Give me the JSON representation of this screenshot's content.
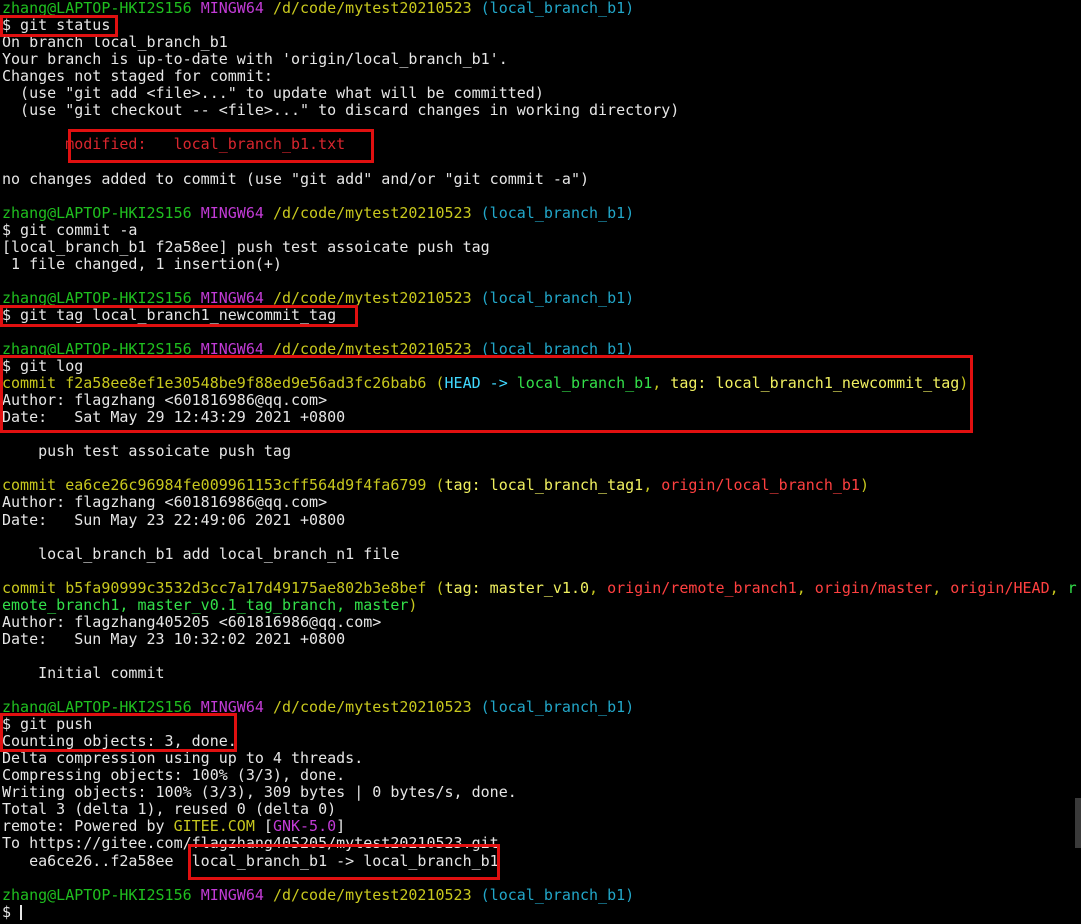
{
  "terminal": {
    "lines": [
      [
        [
          "zhang@LAPTOP-HKI2S156 ",
          "green"
        ],
        [
          "MINGW64 ",
          "magenta"
        ],
        [
          "/d/code/mytest20210523 ",
          "yellow"
        ],
        [
          "(local_branch_b1)",
          "cyan"
        ]
      ],
      [
        [
          "$ git status",
          "white"
        ]
      ],
      [
        [
          "On branch local_branch_b1",
          "white"
        ]
      ],
      [
        [
          "Your branch is up-to-date with 'origin/local_branch_b1'.",
          "white"
        ]
      ],
      [
        [
          "Changes not staged for commit:",
          "white"
        ]
      ],
      [
        [
          "  (use \"git add <file>...\" to update what will be committed)",
          "white"
        ]
      ],
      [
        [
          "  (use \"git checkout -- <file>...\" to discard changes in working directory)",
          "white"
        ]
      ],
      [
        [
          "",
          "white"
        ]
      ],
      [
        [
          "       modified:   local_branch_b1.txt",
          "red"
        ]
      ],
      [
        [
          "",
          "white"
        ]
      ],
      [
        [
          "no changes added to commit (use \"git add\" and/or \"git commit -a\")",
          "white"
        ]
      ],
      [
        [
          "",
          "white"
        ]
      ],
      [
        [
          "zhang@LAPTOP-HKI2S156 ",
          "green"
        ],
        [
          "MINGW64 ",
          "magenta"
        ],
        [
          "/d/code/mytest20210523 ",
          "yellow"
        ],
        [
          "(local_branch_b1)",
          "cyan"
        ]
      ],
      [
        [
          "$ git commit -a",
          "white"
        ]
      ],
      [
        [
          "[local_branch_b1 f2a58ee] push test assoicate push tag",
          "white"
        ]
      ],
      [
        [
          " 1 file changed, 1 insertion(+)",
          "white"
        ]
      ],
      [
        [
          "",
          "white"
        ]
      ],
      [
        [
          "zhang@LAPTOP-HKI2S156 ",
          "green"
        ],
        [
          "MINGW64 ",
          "magenta"
        ],
        [
          "/d/code/mytest20210523 ",
          "yellow"
        ],
        [
          "(local_branch_b1)",
          "cyan"
        ]
      ],
      [
        [
          "$ git tag local_branch1_newcommit_tag",
          "white"
        ]
      ],
      [
        [
          "",
          "white"
        ]
      ],
      [
        [
          "zhang@LAPTOP-HKI2S156 ",
          "green"
        ],
        [
          "MINGW64 ",
          "magenta"
        ],
        [
          "/d/code/mytest20210523 ",
          "yellow"
        ],
        [
          "(local_branch_b1)",
          "cyan"
        ]
      ],
      [
        [
          "$ git log",
          "white"
        ]
      ],
      [
        [
          "commit f2a58ee8ef1e30548be9f88ed9e56ad3fc26bab6 ",
          "yellow"
        ],
        [
          "(",
          "yellow"
        ],
        [
          "HEAD -> ",
          "bright-cyan"
        ],
        [
          "local_branch_b1",
          "bright-green"
        ],
        [
          ", ",
          "yellow"
        ],
        [
          "tag: local_branch1_newcommit_tag",
          "bright-yellow"
        ],
        [
          ")",
          "yellow"
        ]
      ],
      [
        [
          "Author: flagzhang <601816986@qq.com>",
          "white"
        ]
      ],
      [
        [
          "Date:   Sat May 29 12:43:29 2021 +0800",
          "white"
        ]
      ],
      [
        [
          "",
          "white"
        ]
      ],
      [
        [
          "    push test assoicate push tag",
          "white"
        ]
      ],
      [
        [
          "",
          "white"
        ]
      ],
      [
        [
          "commit ea6ce26c96984fe009961153cff564d9f4fa6799 ",
          "yellow"
        ],
        [
          "(",
          "yellow"
        ],
        [
          "tag: local_branch_tag1",
          "bright-yellow"
        ],
        [
          ", ",
          "yellow"
        ],
        [
          "origin/local_branch_b1",
          "bright-red"
        ],
        [
          ")",
          "yellow"
        ]
      ],
      [
        [
          "Author: flagzhang <601816986@qq.com>",
          "white"
        ]
      ],
      [
        [
          "Date:   Sun May 23 22:49:06 2021 +0800",
          "white"
        ]
      ],
      [
        [
          "",
          "white"
        ]
      ],
      [
        [
          "    local_branch_b1 add local_branch_n1 file",
          "white"
        ]
      ],
      [
        [
          "",
          "white"
        ]
      ],
      [
        [
          "commit b5fa90999c3532d3cc7a17d49175ae802b3e8bef ",
          "yellow"
        ],
        [
          "(",
          "yellow"
        ],
        [
          "tag: master_v1.0",
          "bright-yellow"
        ],
        [
          ", ",
          "yellow"
        ],
        [
          "origin/remote_branch1",
          "bright-red"
        ],
        [
          ", ",
          "yellow"
        ],
        [
          "origin/master",
          "bright-red"
        ],
        [
          ", ",
          "yellow"
        ],
        [
          "origin/HEAD",
          "bright-red"
        ],
        [
          ", ",
          "yellow"
        ],
        [
          "r",
          "bright-green"
        ]
      ],
      [
        [
          "emote_branch1, master_v0.1_tag_branch, master",
          "bright-green"
        ],
        [
          ")",
          "yellow"
        ]
      ],
      [
        [
          "Author: flagzhang405205 <601816986@qq.com>",
          "white"
        ]
      ],
      [
        [
          "Date:   Sun May 23 10:32:02 2021 +0800",
          "white"
        ]
      ],
      [
        [
          "",
          "white"
        ]
      ],
      [
        [
          "    Initial commit",
          "white"
        ]
      ],
      [
        [
          "",
          "white"
        ]
      ],
      [
        [
          "zhang@LAPTOP-HKI2S156 ",
          "green"
        ],
        [
          "MINGW64 ",
          "magenta"
        ],
        [
          "/d/code/mytest20210523 ",
          "yellow"
        ],
        [
          "(local_branch_b1)",
          "cyan"
        ]
      ],
      [
        [
          "$ git push",
          "white"
        ]
      ],
      [
        [
          "Counting objects: 3, done.",
          "white"
        ]
      ],
      [
        [
          "Delta compression using up to 4 threads.",
          "white"
        ]
      ],
      [
        [
          "Compressing objects: 100% (3/3), done.",
          "white"
        ]
      ],
      [
        [
          "Writing objects: 100% (3/3), 309 bytes | 0 bytes/s, done.",
          "white"
        ]
      ],
      [
        [
          "Total 3 (delta 1), reused 0 (delta 0)",
          "white"
        ]
      ],
      [
        [
          "remote: Powered by ",
          "white"
        ],
        [
          "GITEE.COM ",
          "yellow"
        ],
        [
          "[",
          "white"
        ],
        [
          "GNK-5.0",
          "magenta"
        ],
        [
          "]",
          "white"
        ]
      ],
      [
        [
          "To https://gitee.com/flagzhang405205/mytest20210523.git",
          "white"
        ]
      ],
      [
        [
          "   ea6ce26..f2a58ee  local_branch_b1 -> local_branch_b1",
          "white"
        ]
      ],
      [
        [
          "",
          "white"
        ]
      ],
      [
        [
          "zhang@LAPTOP-HKI2S156 ",
          "green"
        ],
        [
          "MINGW64 ",
          "magenta"
        ],
        [
          "/d/code/mytest20210523 ",
          "yellow"
        ],
        [
          "(local_branch_b1)",
          "cyan"
        ]
      ],
      [
        [
          "$ ",
          "white"
        ]
      ]
    ]
  }
}
